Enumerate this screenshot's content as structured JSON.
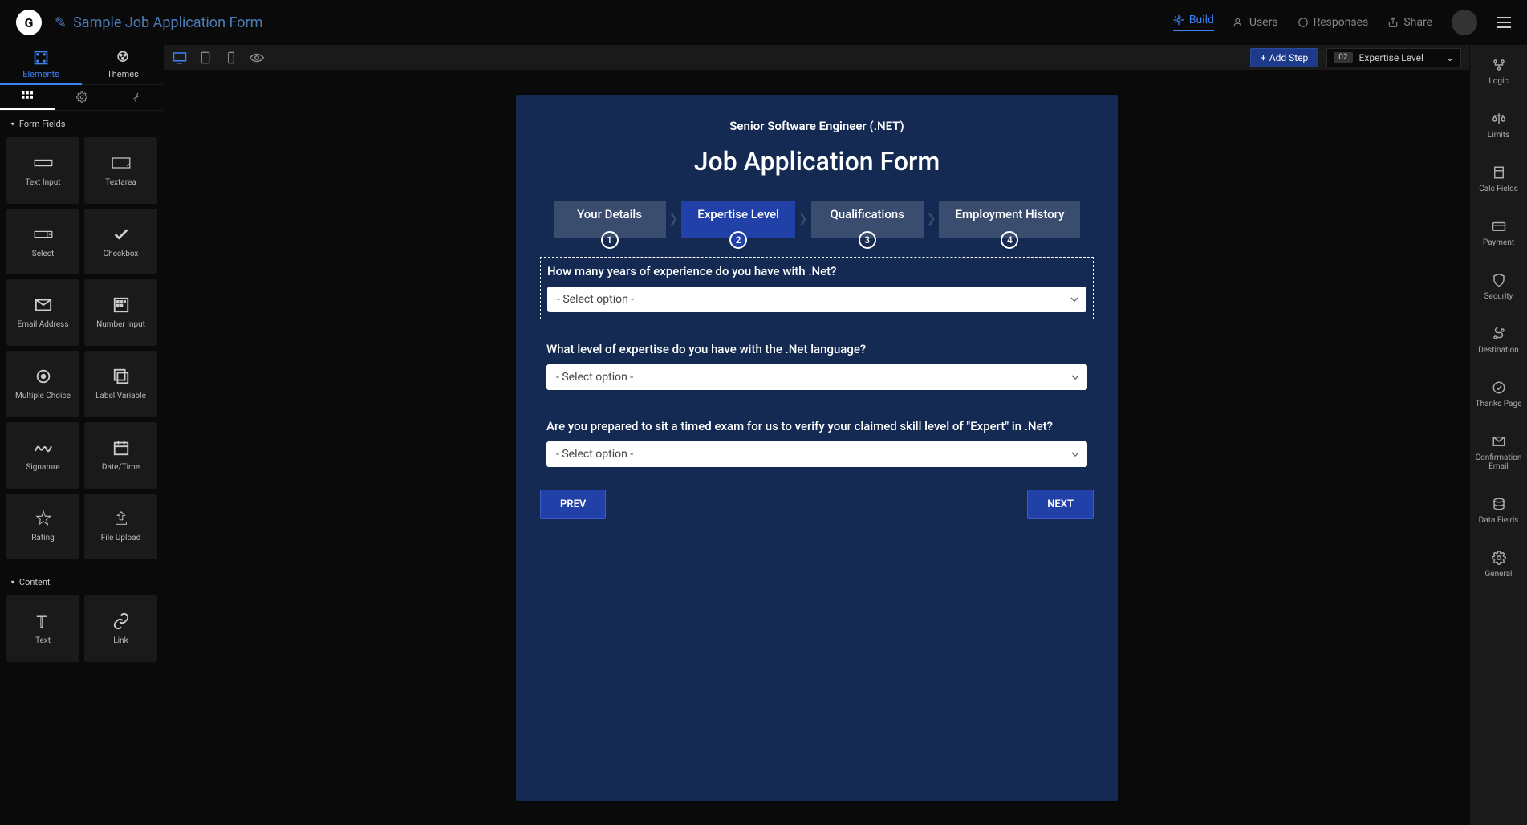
{
  "header": {
    "title": "Sample Job Application Form",
    "nav": {
      "build": "Build",
      "users": "Users",
      "responses": "Responses",
      "share": "Share"
    }
  },
  "left": {
    "tabs": {
      "elements": "Elements",
      "themes": "Themes"
    },
    "section_fields": "Form Fields",
    "section_content": "Content",
    "fields": {
      "text_input": "Text Input",
      "textarea": "Textarea",
      "select": "Select",
      "checkbox": "Checkbox",
      "email": "Email Address",
      "number": "Number Input",
      "multiple_choice": "Multiple Choice",
      "label_var": "Label Variable",
      "signature": "Signature",
      "datetime": "Date/Time",
      "rating": "Rating",
      "file_upload": "File Upload"
    },
    "content": {
      "text": "Text",
      "link": "Link"
    }
  },
  "toolbar": {
    "add_step": "Add Step",
    "step_num": "02",
    "step_name": "Expertise Level"
  },
  "form": {
    "subtitle": "Senior Software Engineer (.NET)",
    "title": "Job Application Form",
    "steps": [
      "Your Details",
      "Expertise Level",
      "Qualifications",
      "Employment History"
    ],
    "q1": "How many years of experience do you have with .Net?",
    "q2": "What level of expertise do you have with the .Net language?",
    "q3": "Are you prepared to sit a timed exam for us to verify your claimed skill level of \"Expert\" in .Net?",
    "placeholder": "- Select option -",
    "prev": "PREV",
    "next": "NEXT"
  },
  "right": {
    "logic": "Logic",
    "limits": "Limits",
    "calc": "Calc Fields",
    "payment": "Payment",
    "security": "Security",
    "destination": "Destination",
    "thanks": "Thanks Page",
    "confirmation": "Confirmation Email",
    "data_fields": "Data Fields",
    "general": "General"
  }
}
